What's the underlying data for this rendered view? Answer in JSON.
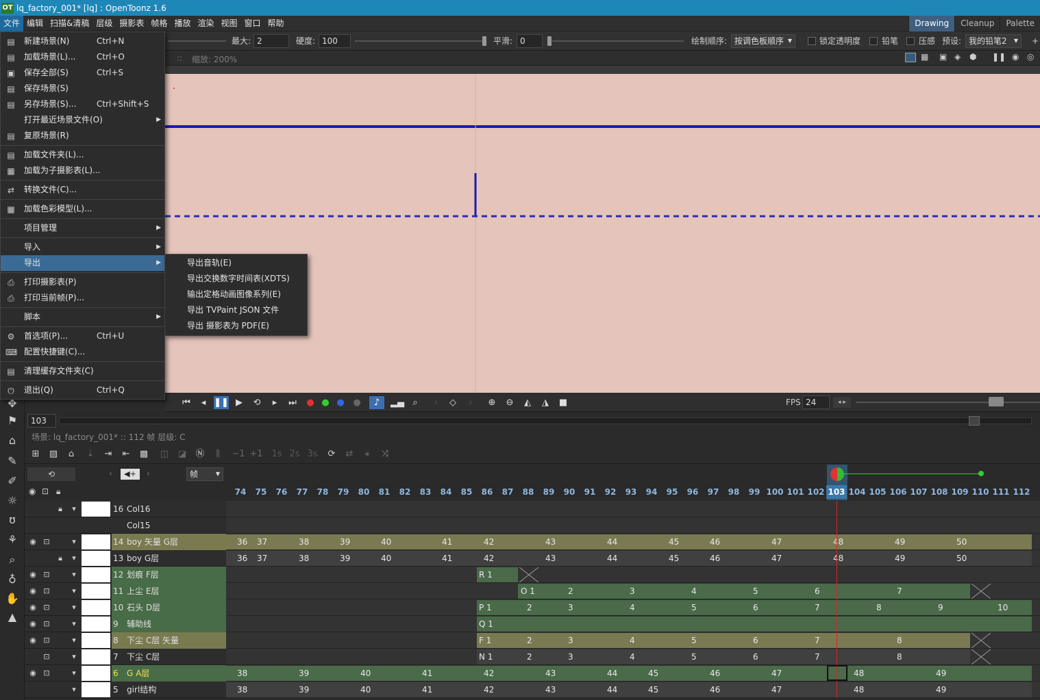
{
  "window": {
    "title": "lq_factory_001* [lq] : OpenToonz 1.6",
    "logo": "OT"
  },
  "menubar": {
    "items": [
      "文件",
      "编辑",
      "扫描&清稿",
      "层级",
      "摄影表",
      "帧格",
      "播放",
      "渲染",
      "视图",
      "窗口",
      "帮助"
    ],
    "rooms": [
      "Drawing",
      "Cleanup",
      "Palette"
    ]
  },
  "tool_options": {
    "max_label": "最大:",
    "max_value": "2",
    "hardness_label": "硬度:",
    "hardness_value": "100",
    "smooth_label": "平滑:",
    "smooth_value": "0",
    "draw_order_label": "绘制顺序:",
    "draw_order_value": "按调色板顺序",
    "lock_alpha_label": "锁定透明度",
    "pencil_label": "铅笔",
    "pressure_label": "压感",
    "preset_label": "预设:",
    "preset_value": "我的铅笔2",
    "plus": "+"
  },
  "viewer": {
    "zoom_text": "缩放: 200%",
    "sep": "::"
  },
  "file_menu": {
    "items": [
      {
        "label": "新建场景(N)",
        "shortcut": "Ctrl+N",
        "icon": "new-scene-icon"
      },
      {
        "label": "加载场景(L)...",
        "shortcut": "Ctrl+O",
        "icon": "load-scene-icon"
      },
      {
        "label": "保存全部(S)",
        "shortcut": "Ctrl+S",
        "icon": "save-all-icon"
      },
      {
        "label": "保存场景(S)",
        "shortcut": "",
        "icon": "save-scene-icon"
      },
      {
        "label": "另存场景(S)...",
        "shortcut": "Ctrl+Shift+S",
        "icon": "save-scene-as-icon"
      },
      {
        "label": "打开最近场景文件(O)",
        "shortcut": "",
        "icon": ""
      },
      {
        "label": "复原场景(R)",
        "shortcut": "",
        "icon": "revert-scene-icon"
      },
      {
        "label": "加载文件夹(L)...",
        "shortcut": "",
        "icon": "load-folder-icon"
      },
      {
        "label": "加载为子摄影表(L)...",
        "shortcut": "",
        "icon": "load-subxsheet-icon"
      },
      {
        "label": "转换文件(C)...",
        "shortcut": "",
        "icon": "convert-icon"
      },
      {
        "label": "加载色彩模型(L)...",
        "shortcut": "",
        "icon": "color-model-icon"
      },
      {
        "label": "项目管理",
        "shortcut": "",
        "icon": ""
      },
      {
        "label": "导入",
        "shortcut": "",
        "icon": ""
      },
      {
        "label": "导出",
        "shortcut": "",
        "icon": ""
      },
      {
        "label": "打印摄影表(P)",
        "shortcut": "",
        "icon": "print-icon"
      },
      {
        "label": "打印当前帧(P)...",
        "shortcut": "",
        "icon": "print-frame-icon"
      },
      {
        "label": "脚本",
        "shortcut": "",
        "icon": ""
      },
      {
        "label": "首选项(P)...",
        "shortcut": "Ctrl+U",
        "icon": "gear-icon"
      },
      {
        "label": "配置快捷键(C)...",
        "shortcut": "",
        "icon": "keyboard-icon"
      },
      {
        "label": "清理缓存文件夹(C)",
        "shortcut": "",
        "icon": "clear-cache-icon"
      },
      {
        "label": "退出(Q)",
        "shortcut": "Ctrl+Q",
        "icon": "power-icon"
      }
    ]
  },
  "export_submenu": {
    "items": [
      "导出音轨(E)",
      "导出交换数字时间表(XDTS)",
      "输出定格动画图像系列(E)",
      "导出 TVPaint JSON 文件",
      "导出 摄影表为 PDF(E)"
    ]
  },
  "playback": {
    "fps_label": "FPS",
    "fps_value": "24"
  },
  "frame_field": {
    "value": "103"
  },
  "xsheet": {
    "info": "场景: lq_factory_001*   ::   112 帧  层级: C",
    "frame_mode": "帧",
    "frames": [
      "74",
      "75",
      "76",
      "77",
      "78",
      "79",
      "80",
      "81",
      "82",
      "83",
      "84",
      "85",
      "86",
      "87",
      "88",
      "89",
      "90",
      "91",
      "92",
      "93",
      "94",
      "95",
      "96",
      "97",
      "98",
      "99",
      "100",
      "101",
      "102",
      "103",
      "104",
      "105",
      "106",
      "107",
      "108",
      "109",
      "110",
      "111",
      "112"
    ],
    "current_frame": "103",
    "layers": [
      {
        "num": "16",
        "name": "Col16"
      },
      {
        "num": "",
        "name": "Col15"
      },
      {
        "num": "14",
        "name": "boy 矢量 G层"
      },
      {
        "num": "13",
        "name": "boy G层"
      },
      {
        "num": "12",
        "name": "划痕 F层"
      },
      {
        "num": "11",
        "name": "上尘 E层"
      },
      {
        "num": "10",
        "name": "石头 D层"
      },
      {
        "num": "9",
        "name": "辅助线"
      },
      {
        "num": "8",
        "name": "下尘 C层 矢量"
      },
      {
        "num": "7",
        "name": "下尘 C层"
      },
      {
        "num": "6",
        "name": "G A层"
      },
      {
        "num": "5",
        "name": "girl结构"
      }
    ],
    "row_cells": {
      "r14": [
        "36",
        "37",
        "38",
        "39",
        "40",
        "41",
        "42",
        "43",
        "44",
        "45",
        "46",
        "47",
        "48",
        "49",
        "50"
      ],
      "r13": [
        "36",
        "37",
        "38",
        "39",
        "40",
        "41",
        "42",
        "43",
        "44",
        "45",
        "46",
        "47",
        "48",
        "49",
        "50"
      ],
      "r12": [
        "R 1"
      ],
      "r11": [
        "O 1",
        "2",
        "3",
        "4",
        "5",
        "6",
        "7"
      ],
      "r10": [
        "P 1",
        "2",
        "3",
        "4",
        "5",
        "6",
        "7",
        "8",
        "9",
        "10"
      ],
      "r9": [
        "Q 1"
      ],
      "r8": [
        "F 1",
        "2",
        "3",
        "4",
        "5",
        "6",
        "7",
        "8"
      ],
      "r7": [
        "N 1",
        "2",
        "3",
        "4",
        "5",
        "6",
        "7",
        "8"
      ],
      "r6": [
        "38",
        "39",
        "40",
        "41",
        "42",
        "43",
        "44",
        "45",
        "46",
        "47",
        "48",
        "49"
      ],
      "r5": [
        "38",
        "39",
        "40",
        "41",
        "42",
        "43",
        "44",
        "45",
        "46",
        "47",
        "48",
        "49"
      ]
    }
  },
  "colors": {
    "accent": "#1e87b8",
    "canvas": "#e5c4bb",
    "vector_layer": "#7a7a52",
    "level_layer": "#4a6a4a",
    "stroke": "#1a1ab0"
  }
}
